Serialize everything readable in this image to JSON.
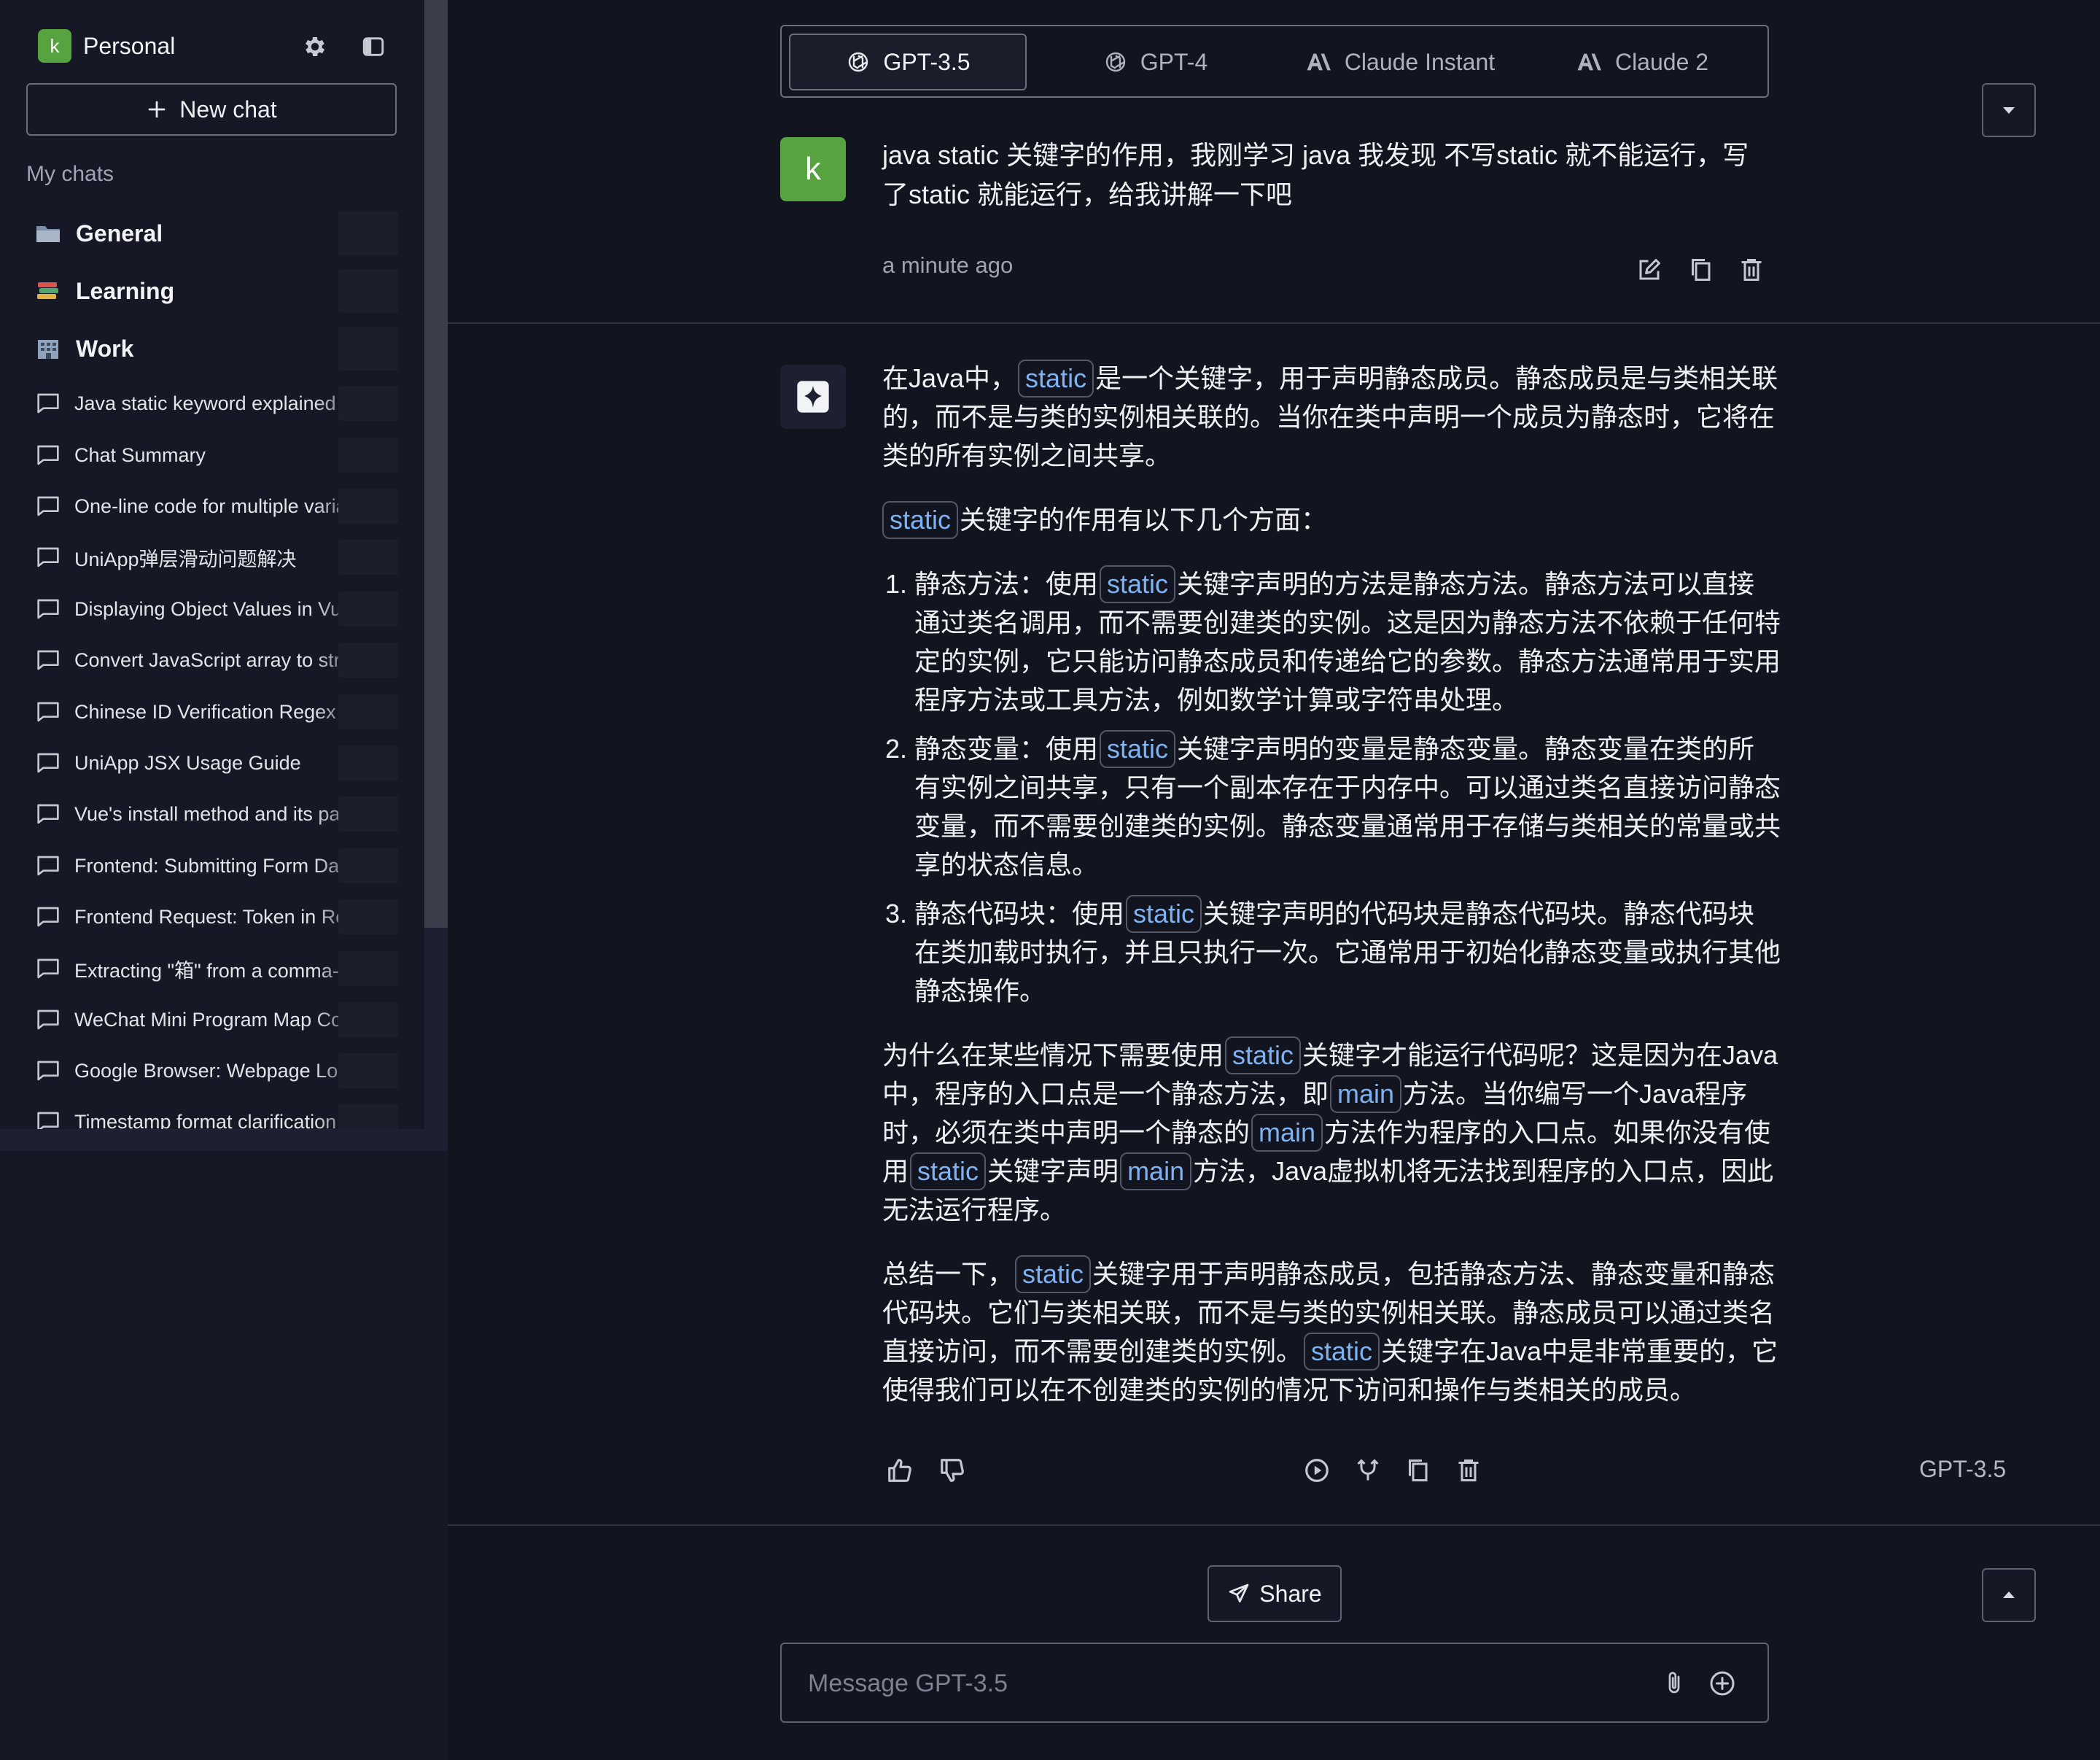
{
  "sidebar": {
    "workspace": {
      "avatar_letter": "k",
      "name": "Personal"
    },
    "new_chat_label": "New chat",
    "section_label": "My chats",
    "folders": [
      {
        "label": "General",
        "icon": "folder-icon"
      },
      {
        "label": "Learning",
        "icon": "books-icon"
      },
      {
        "label": "Work",
        "icon": "office-icon"
      }
    ],
    "chats": [
      {
        "label": "Java static keyword explained"
      },
      {
        "label": "Chat Summary"
      },
      {
        "label": "One-line code for multiple varia"
      },
      {
        "label": "UniApp弹层滑动问题解决"
      },
      {
        "label": "Displaying Object Values in Vue"
      },
      {
        "label": "Convert JavaScript array to strin"
      },
      {
        "label": "Chinese ID Verification Regex"
      },
      {
        "label": "UniApp JSX Usage Guide"
      },
      {
        "label": "Vue's install method and its para"
      },
      {
        "label": "Frontend: Submitting Form Data"
      },
      {
        "label": "Frontend Request: Token in Req"
      },
      {
        "label": "Extracting \"箱\" from a comma-s"
      },
      {
        "label": "WeChat Mini Program Map Com"
      },
      {
        "label": "Google Browser: Webpage Long"
      },
      {
        "label": "Timestamp format clarification"
      }
    ]
  },
  "models": [
    {
      "label": "GPT-3.5",
      "icon": "openai-icon",
      "active": true
    },
    {
      "label": "GPT-4",
      "icon": "openai-icon",
      "active": false
    },
    {
      "label": "Claude Instant",
      "icon": "anthropic-icon",
      "active": false
    },
    {
      "label": "Claude 2",
      "icon": "anthropic-icon",
      "active": false
    }
  ],
  "user_message": {
    "avatar_letter": "k",
    "text": "java static 关键字的作用，我刚学习 java 我发现 不写static 就不能运行，写了static 就能运行，给我讲解一下吧",
    "time": "a minute ago"
  },
  "assistant_message": {
    "p1": {
      "a": "在Java中，",
      "code": "static",
      "b": "是一个关键字，用于声明静态成员。静态成员是与类相关联的，而不是与类的实例相关联的。当你在类中声明一个成员为静态时，它将在类的所有实例之间共享。"
    },
    "p2": {
      "code": "static",
      "b": "关键字的作用有以下几个方面："
    },
    "list": [
      {
        "a": "静态方法：使用",
        "code": "static",
        "b": "关键字声明的方法是静态方法。静态方法可以直接通过类名调用，而不需要创建类的实例。这是因为静态方法不依赖于任何特定的实例，它只能访问静态成员和传递给它的参数。静态方法通常用于实用程序方法或工具方法，例如数学计算或字符串处理。"
      },
      {
        "a": "静态变量：使用",
        "code": "static",
        "b": "关键字声明的变量是静态变量。静态变量在类的所有实例之间共享，只有一个副本存在于内存中。可以通过类名直接访问静态变量，而不需要创建类的实例。静态变量通常用于存储与类相关的常量或共享的状态信息。"
      },
      {
        "a": "静态代码块：使用",
        "code": "static",
        "b": "关键字声明的代码块是静态代码块。静态代码块在类加载时执行，并且只执行一次。它通常用于初始化静态变量或执行其他静态操作。"
      }
    ],
    "p4": {
      "a": "为什么在某些情况下需要使用",
      "code1": "static",
      "b": "关键字才能运行代码呢？这是因为在Java中，程序的入口点是一个静态方法，即",
      "code2": "main",
      "c": "方法。当你编写一个Java程序时，必须在类中声明一个静态的",
      "code3": "main",
      "d": "方法作为程序的入口点。如果你没有使用",
      "code4": "static",
      "e": "关键字声明",
      "code5": "main",
      "f": "方法，Java虚拟机将无法找到程序的入口点，因此无法运行程序。"
    },
    "p5": {
      "a": "总结一下，",
      "code1": "static",
      "b": "关键字用于声明静态成员，包括静态方法、静态变量和静态代码块。它们与类相关联，而不是与类的实例相关联。静态成员可以通过类名直接访问，而不需要创建类的实例。",
      "code2": "static",
      "c": "关键字在Java中是非常重要的，它使得我们可以在不创建类的实例的情况下访问和操作与类相关的成员。"
    },
    "model_label": "GPT-3.5"
  },
  "share_label": "Share",
  "composer": {
    "placeholder": "Message GPT-3.5",
    "value": ""
  },
  "colors": {
    "background": "#121520",
    "sidebar": "#161925",
    "accent_green": "#57a33f",
    "code_text": "#7fb2f0",
    "border": "#6b6f7c"
  }
}
